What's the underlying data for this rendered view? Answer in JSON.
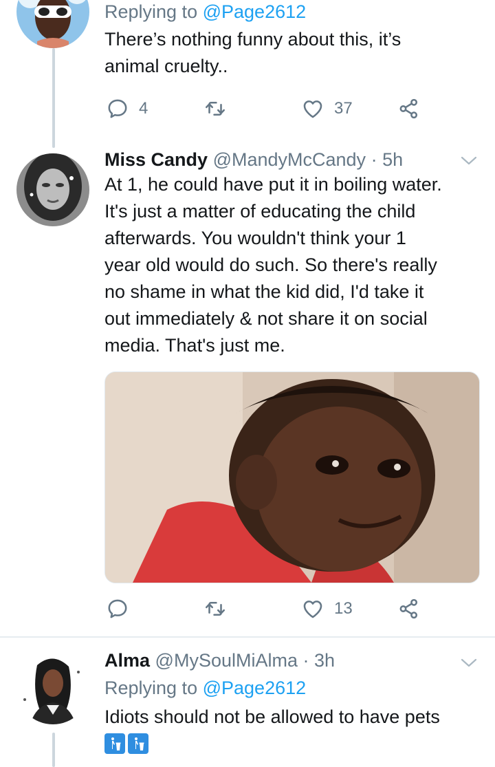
{
  "tweets": [
    {
      "replying_prefix": "Replying to",
      "replying_handle": "@Page2612",
      "text_line1": "There’s nothing funny about this, it’s",
      "text_line2": "animal cruelty..",
      "reply_count": "4",
      "retweet_count": "",
      "like_count": "37"
    },
    {
      "name": "Miss Candy",
      "handle": "@MandyMcCandy",
      "separator": "·",
      "time": "5h",
      "lines": [
        "At 1, he could have put it in boiling water.",
        "It's just a matter of educating the child",
        "afterwards. You wouldn't think your 1",
        "year old would do such. So there's really",
        "no shame in what the kid did, I'd take it",
        "out immediately & not share it on social",
        "media. That's just me."
      ],
      "reply_count": "",
      "retweet_count": "",
      "like_count": "13"
    },
    {
      "name": "Alma",
      "handle": "@MySoulMiAlma",
      "separator": "·",
      "time": "3h",
      "replying_prefix": "Replying to",
      "replying_handle": "@Page2612",
      "text": "Idiots should not be allowed to have pets",
      "emoji_icons": [
        "litter-in-bin-icon",
        "litter-in-bin-icon"
      ]
    }
  ],
  "colors": {
    "accent": "#1da1f2",
    "secondary_text": "#657786",
    "thread_line": "#ccd6dd",
    "divider": "#e6ecf0"
  }
}
